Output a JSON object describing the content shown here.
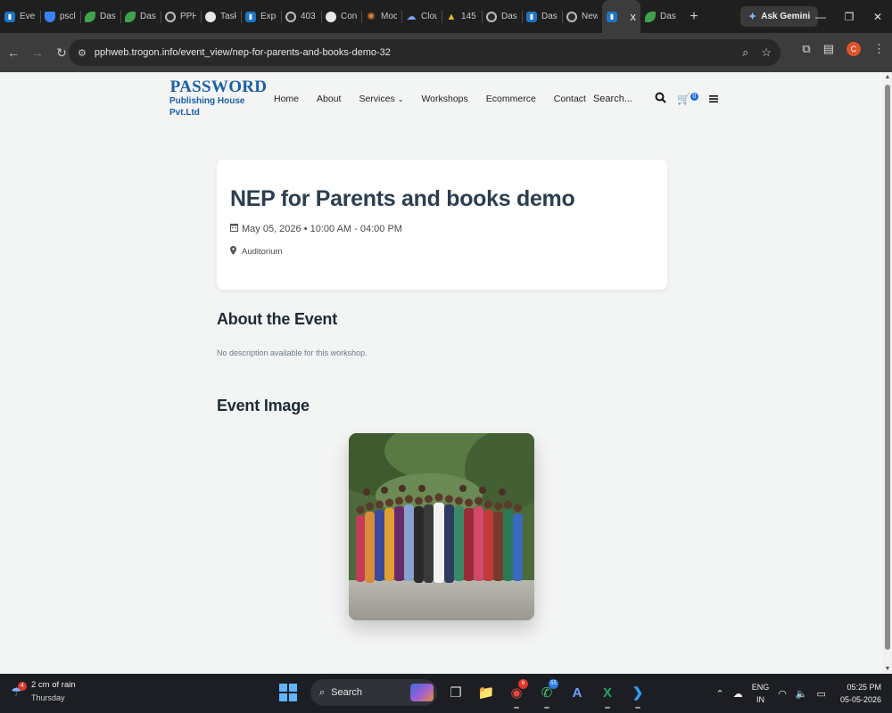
{
  "browser": {
    "tabs": [
      {
        "label": "Ever",
        "icon": "doc-icon"
      },
      {
        "label": "pscl",
        "icon": "shield-icon"
      },
      {
        "label": "Dasl",
        "icon": "leaf-icon"
      },
      {
        "label": "Dasl",
        "icon": "leaf-icon"
      },
      {
        "label": "PPH",
        "icon": "globe-icon"
      },
      {
        "label": "Task",
        "icon": "chatgpt-icon"
      },
      {
        "label": "Expi",
        "icon": "doc-icon"
      },
      {
        "label": "403",
        "icon": "globe-icon"
      },
      {
        "label": "Con",
        "icon": "chatgpt-icon"
      },
      {
        "label": "Moc",
        "icon": "star-burst-icon"
      },
      {
        "label": "Clou",
        "icon": "cloud-icon"
      },
      {
        "label": "145",
        "icon": "mountain-icon"
      },
      {
        "label": "Dasl",
        "icon": "globe-icon"
      },
      {
        "label": "Dasl",
        "icon": "doc-icon"
      },
      {
        "label": "New",
        "icon": "chrome-icon"
      },
      {
        "label": "",
        "icon": "doc-icon",
        "active": true
      },
      {
        "label": "Dasl",
        "icon": "leaf-icon"
      }
    ],
    "new_tab_symbol": "+",
    "close_symbol": "x",
    "gemini_label": "Ask Gemini",
    "url": "pphweb.trogon.info/event_view/nep-for-parents-and-books-demo-32",
    "profile_initial": "C"
  },
  "site": {
    "logo_word": "PASSWORD",
    "logo_sub": "Publishing House Pvt.Ltd",
    "nav": {
      "home": "Home",
      "about": "About",
      "services": "Services",
      "workshops": "Workshops",
      "ecommerce": "Ecommerce",
      "contact": "Contact"
    },
    "search_placeholder": "Search...",
    "cart_count": "0"
  },
  "event": {
    "title": "NEP for Parents and books demo",
    "datetime": "May 05, 2026 • 10:00 AM - 04:00 PM",
    "location": "Auditorium"
  },
  "about_section": {
    "heading": "About the Event",
    "text": "No description available for this workshop."
  },
  "image_section": {
    "heading": "Event Image"
  },
  "taskbar": {
    "weather_badge": "4",
    "weather_title": "2 cm of rain",
    "weather_day": "Thursday",
    "search_label": "Search",
    "chrome_badge": "6",
    "whatsapp_badge": "55",
    "lang_top": "ENG",
    "lang_bottom": "IN",
    "time": "05:25 PM",
    "date": "05-05-2026"
  },
  "colors": {
    "brand_blue": "#1a5fa8",
    "title_text": "#2c3e50",
    "page_bg": "#f3f4f4",
    "cart_blue": "#1a6fe0"
  }
}
